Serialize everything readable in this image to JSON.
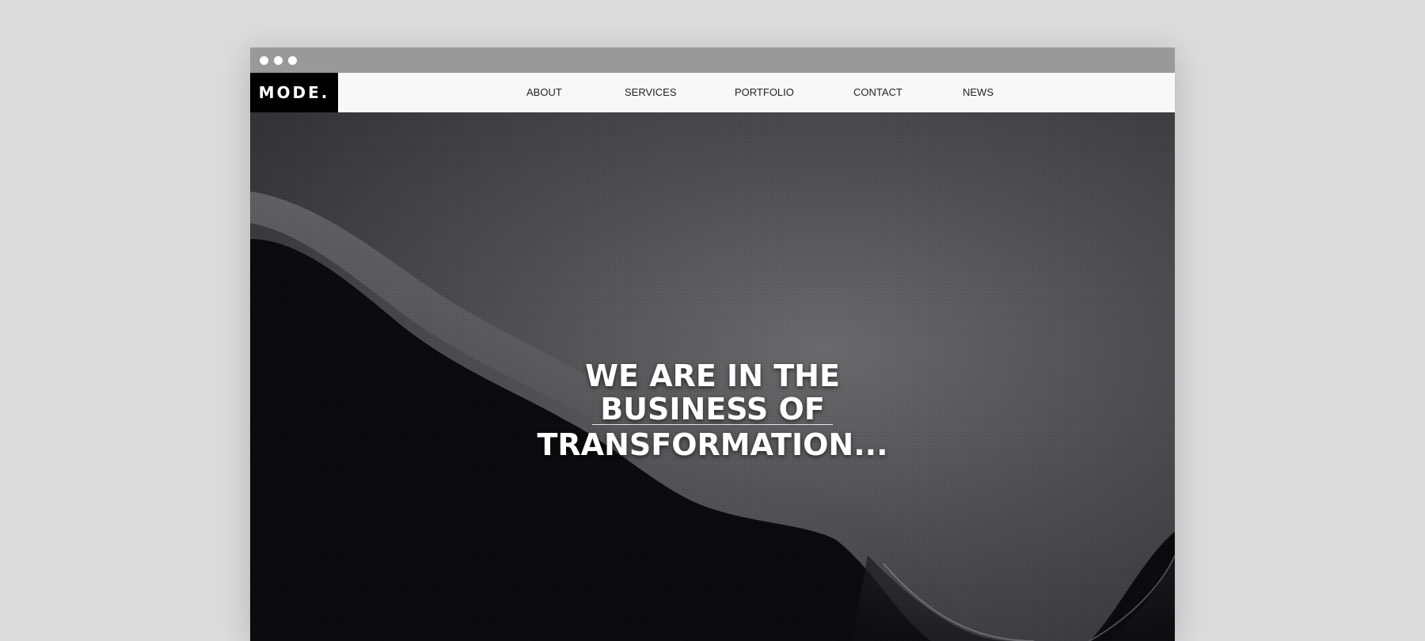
{
  "window": {
    "controls": [
      "window-dot",
      "window-dot",
      "window-dot"
    ]
  },
  "header": {
    "logo": "MODE.",
    "nav": [
      {
        "label": "ABOUT"
      },
      {
        "label": "SERVICES"
      },
      {
        "label": "PORTFOLIO"
      },
      {
        "label": "CONTACT"
      },
      {
        "label": "NEWS"
      }
    ]
  },
  "hero": {
    "headline_lines": [
      "WE ARE IN THE",
      "BUSINESS OF",
      "TRANSFORMATION..."
    ]
  },
  "colors": {
    "page_bg": "#dcdcdc",
    "titlebar": "#999999",
    "navbar": "#f8f8f8",
    "logo_bg": "#000000",
    "hero_dark": "#0b0b0e",
    "headline": "#ffffff"
  }
}
